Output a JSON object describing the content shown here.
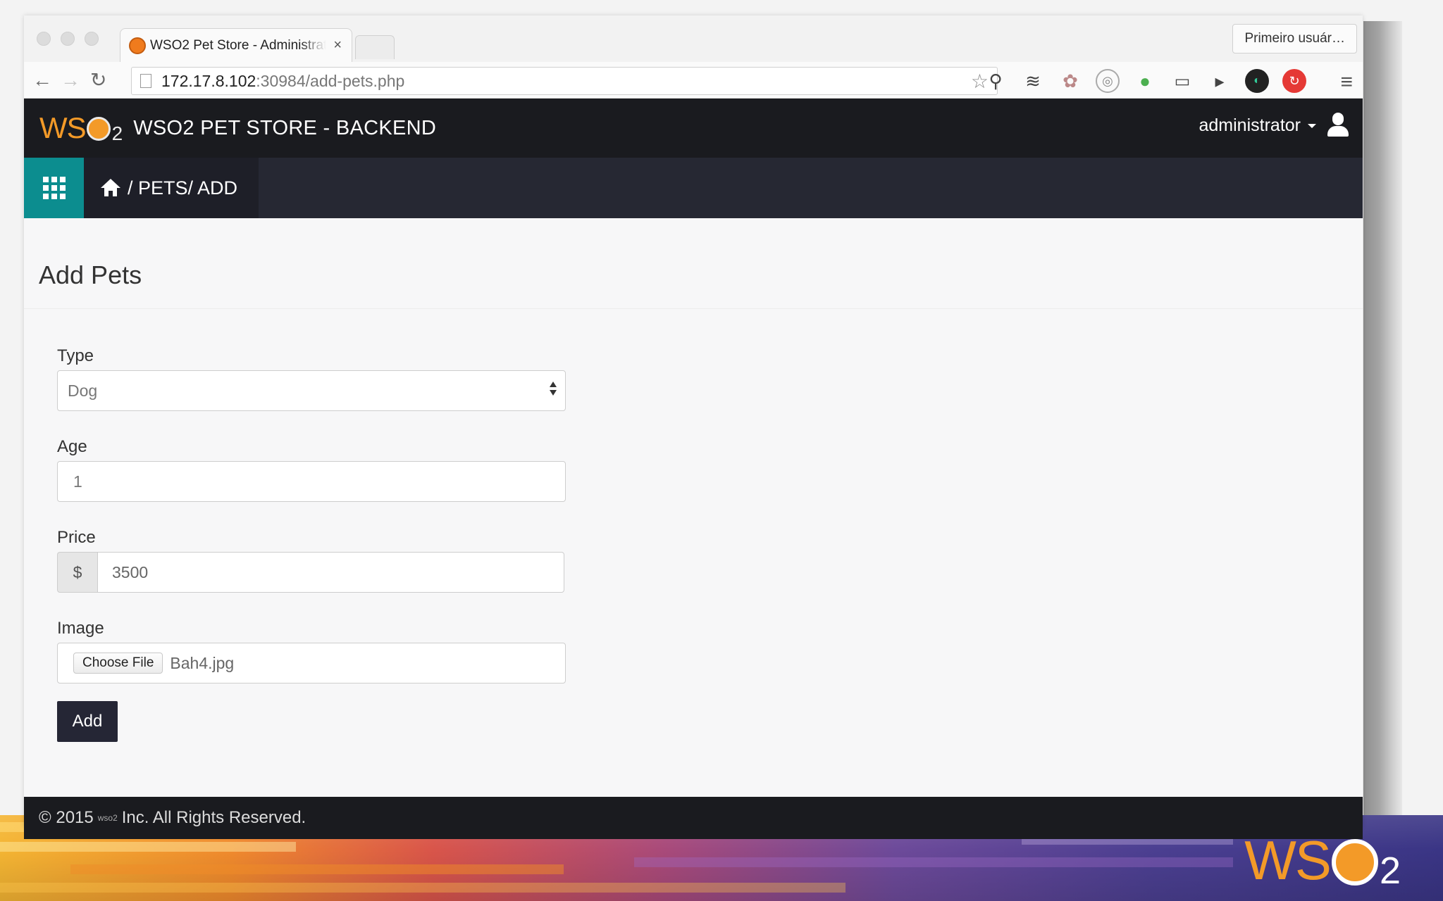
{
  "browser": {
    "tab_title": "WSO2 Pet Store - Administrator",
    "tab_close": "×",
    "profile_button": "Primeiro usuár…",
    "url_host": "172.17.8.102",
    "url_path": ":30984/add-pets.php",
    "icons": [
      "back-icon",
      "forward-icon",
      "reload-icon",
      "page-icon",
      "star-icon",
      "extension-icons",
      "menu-icon"
    ]
  },
  "app": {
    "logo_text": "WS",
    "logo_sub": "2",
    "title": "WSO2 PET STORE - BACKEND",
    "user_name": "administrator"
  },
  "breadcrumb": {
    "path": "/ PETS/ ADD"
  },
  "page": {
    "heading": "Add Pets"
  },
  "form": {
    "type_label": "Type",
    "type_value": "Dog",
    "age_label": "Age",
    "age_value": "1",
    "price_label": "Price",
    "price_addon": "$",
    "price_value": "3500",
    "image_label": "Image",
    "choose_file_label": "Choose File",
    "file_name": "Bah4.jpg",
    "submit_label": "Add"
  },
  "footer": {
    "prefix": "© 2015",
    "mini_logo": "wso2",
    "suffix": "Inc. All Rights Reserved."
  },
  "banner": {
    "logo_text": "WS",
    "logo_sub": "2"
  },
  "colors": {
    "header": "#1a1b1f",
    "breadcrumb_bar": "#262833",
    "accent_teal": "#0c8d8f",
    "wso2_orange": "#f39a28",
    "button": "#252635"
  }
}
